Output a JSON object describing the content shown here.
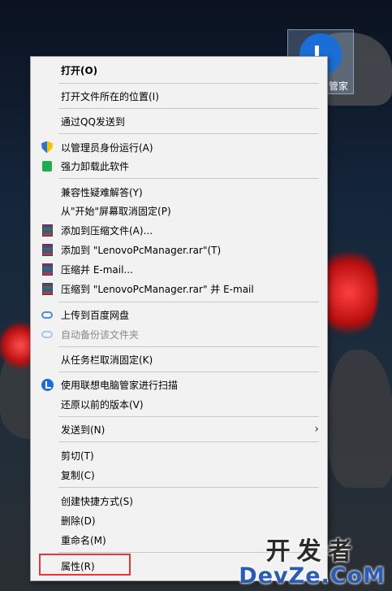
{
  "desktop": {
    "icon_label": "管家"
  },
  "menu": {
    "items": [
      {
        "label": "打开(O)",
        "icon": "none"
      },
      {
        "label": "打开文件所在的位置(I)",
        "icon": "none"
      },
      {
        "label": "通过QQ发送到",
        "icon": "none"
      },
      {
        "label": "以管理员身份运行(A)",
        "icon": "uac-shield-icon"
      },
      {
        "label": "强力卸载此软件",
        "icon": "uninstall-bag-icon"
      },
      {
        "label": "兼容性疑难解答(Y)",
        "icon": "none"
      },
      {
        "label": "从\"开始\"屏幕取消固定(P)",
        "icon": "none"
      },
      {
        "label": "添加到压缩文件(A)...",
        "icon": "winrar-icon"
      },
      {
        "label": "添加到 \"LenovoPcManager.rar\"(T)",
        "icon": "winrar-icon"
      },
      {
        "label": "压缩并 E-mail...",
        "icon": "winrar-icon"
      },
      {
        "label": "压缩到 \"LenovoPcManager.rar\" 并 E-mail",
        "icon": "winrar-icon"
      },
      {
        "label": "上传到百度网盘",
        "icon": "baidu-cloud-icon"
      },
      {
        "label": "自动备份该文件夹",
        "icon": "baidu-cloud-icon",
        "disabled": true
      },
      {
        "label": "从任务栏取消固定(K)",
        "icon": "none"
      },
      {
        "label": "使用联想电脑管家进行扫描",
        "icon": "lenovo-manager-icon"
      },
      {
        "label": "还原以前的版本(V)",
        "icon": "none"
      },
      {
        "label": "发送到(N)",
        "icon": "none",
        "submenu": true
      },
      {
        "label": "剪切(T)",
        "icon": "none"
      },
      {
        "label": "复制(C)",
        "icon": "none"
      },
      {
        "label": "创建快捷方式(S)",
        "icon": "none"
      },
      {
        "label": "删除(D)",
        "icon": "none"
      },
      {
        "label": "重命名(M)",
        "icon": "none"
      },
      {
        "label": "属性(R)",
        "icon": "none",
        "highlighted": true
      }
    ],
    "submenu_arrow": "›"
  },
  "watermark": {
    "line1": "开发者",
    "line2": "DevZe.CoM"
  },
  "colors": {
    "highlight_border": "#e2393f",
    "menu_bg": "#f2f2f2"
  }
}
